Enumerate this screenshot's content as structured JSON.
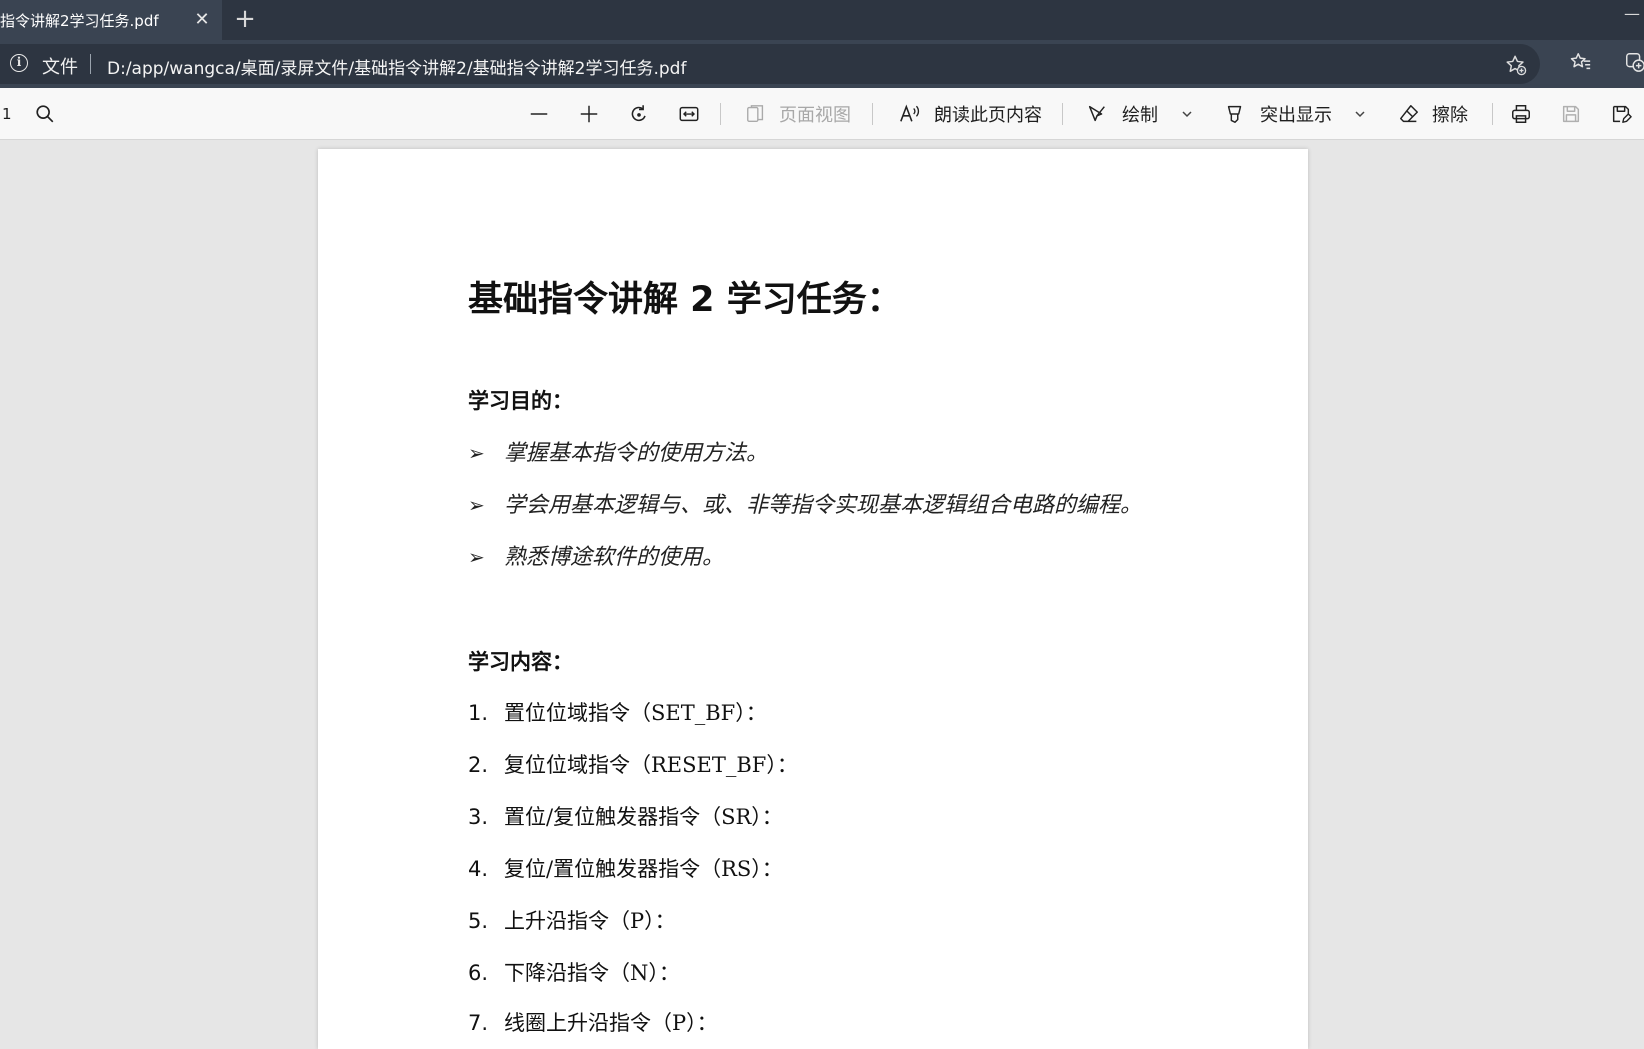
{
  "tab": {
    "title": "指令讲解2学习任务.pdf",
    "close": "✕",
    "new_tab": "+",
    "minimize": "—"
  },
  "address": {
    "file_label": "文件",
    "url": "D:/app/wangca/桌面/录屏文件/基础指令讲解2/基础指令讲解2学习任务.pdf"
  },
  "toolbar": {
    "page_number": "1",
    "page_view": "页面视图",
    "read_aloud": "朗读此页内容",
    "draw": "绘制",
    "highlight": "突出显示",
    "erase": "擦除"
  },
  "document": {
    "title": "基础指令讲解 2 学习任务：",
    "goals_heading": "学习目的：",
    "goals": [
      "掌握基本指令的使用方法。",
      "学会用基本逻辑与、或、非等指令实现基本逻辑组合电路的编程。",
      "熟悉博途软件的使用。"
    ],
    "goal_marker": "➢",
    "content_heading": "学习内容：",
    "items": [
      {
        "num": "1.",
        "text": "置位位域指令（SET_BF）："
      },
      {
        "num": "2.",
        "text": "复位位域指令（RESET_BF）："
      },
      {
        "num": "3.",
        "text": "置位/复位触发器指令（SR）："
      },
      {
        "num": "4.",
        "text": "复位/置位触发器指令（RS）："
      },
      {
        "num": "5.",
        "text": "上升沿指令（P）："
      },
      {
        "num": "6.",
        "text": "下降沿指令（N）："
      },
      {
        "num": "7.",
        "text": "线圈上升沿指令（P）："
      }
    ]
  },
  "colors": {
    "tabbar": "#2d3541",
    "address_bg": "#3a4452",
    "toolbar_bg": "#f8f8f8",
    "workspace": "#e6e6e6"
  }
}
